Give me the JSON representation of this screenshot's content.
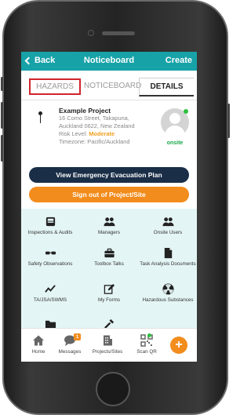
{
  "nav": {
    "back_label": "Back",
    "title": "Noticeboard",
    "create_label": "Create"
  },
  "tabs": {
    "hazards": "HAZARDS",
    "noticeboard": "NOTICEBOARD",
    "details": "DETAILS"
  },
  "project": {
    "name": "Example Project",
    "address_line1": "16 Como Street, Takapuna,",
    "address_line2": "Auckland 0622, New Zealand",
    "risk_label": "Risk Level: ",
    "risk_value": "Moderate",
    "timezone": "Timezone: Pacific/Auckland",
    "status": "onsite"
  },
  "actions": {
    "evacuation": "View Emergency Evacuation Plan",
    "signout": "Sign out of Project/Site"
  },
  "tiles": [
    {
      "label": "Inspections & Audits",
      "icon": "inbox-tray-icon"
    },
    {
      "label": "Managers",
      "icon": "users-icon"
    },
    {
      "label": "Onsite Users",
      "icon": "users-icon"
    },
    {
      "label": "Safety Observations",
      "icon": "glasses-icon"
    },
    {
      "label": "Toolbox Talks",
      "icon": "briefcase-icon"
    },
    {
      "label": "Task Analysis Documents",
      "icon": "document-icon"
    },
    {
      "label": "TA/JSA/SWMS",
      "icon": "line-chart-icon"
    },
    {
      "label": "My Forms",
      "icon": "edit-icon"
    },
    {
      "label": "Hazardous Substances",
      "icon": "radiation-icon"
    }
  ],
  "tabbar": {
    "home": "Home",
    "messages": "Messages",
    "messages_badge": "1",
    "projects": "Projects/Sites",
    "scan": "Scan QR",
    "fab": "+"
  },
  "colors": {
    "primary": "#17a2a8",
    "accent": "#f28c1c",
    "navy": "#1a2e47",
    "highlight": "#d0242b",
    "online": "#2ec040"
  }
}
